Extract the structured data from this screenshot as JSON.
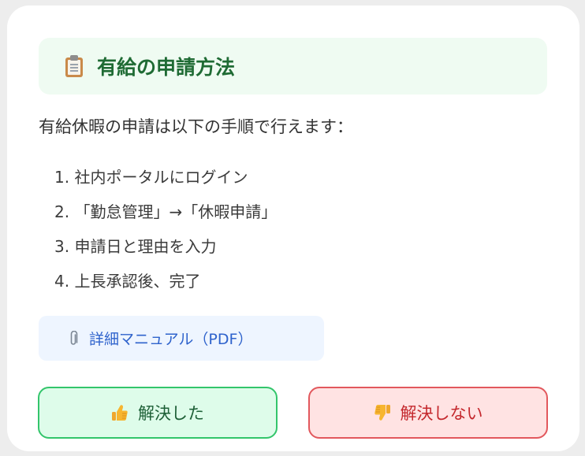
{
  "title": {
    "icon": "clipboard-icon",
    "text": "有給の申請方法"
  },
  "intro": "有給休暇の申請は以下の手順で行えます：",
  "steps": [
    "1. 社内ポータルにログイン",
    "2. 「勤怠管理」→「休暇申請」",
    "3. 申請日と理由を入力",
    "4. 上長承認後、完了"
  ],
  "manual_link": {
    "icon": "paperclip-icon",
    "label": "詳細マニュアル（PDF）"
  },
  "feedback": {
    "resolved": {
      "icon": "thumbs-up-icon",
      "label": "解決した"
    },
    "unresolved": {
      "icon": "thumbs-down-icon",
      "label": "解決しない"
    }
  },
  "colors": {
    "title_bg": "#effbf2",
    "title_text": "#1f6b34",
    "link_bg": "#eef5ff",
    "link_text": "#2f63cc",
    "resolved_bg": "#defcea",
    "resolved_border": "#33c56b",
    "unresolved_bg": "#ffe3e3",
    "unresolved_border": "#e2585d"
  }
}
